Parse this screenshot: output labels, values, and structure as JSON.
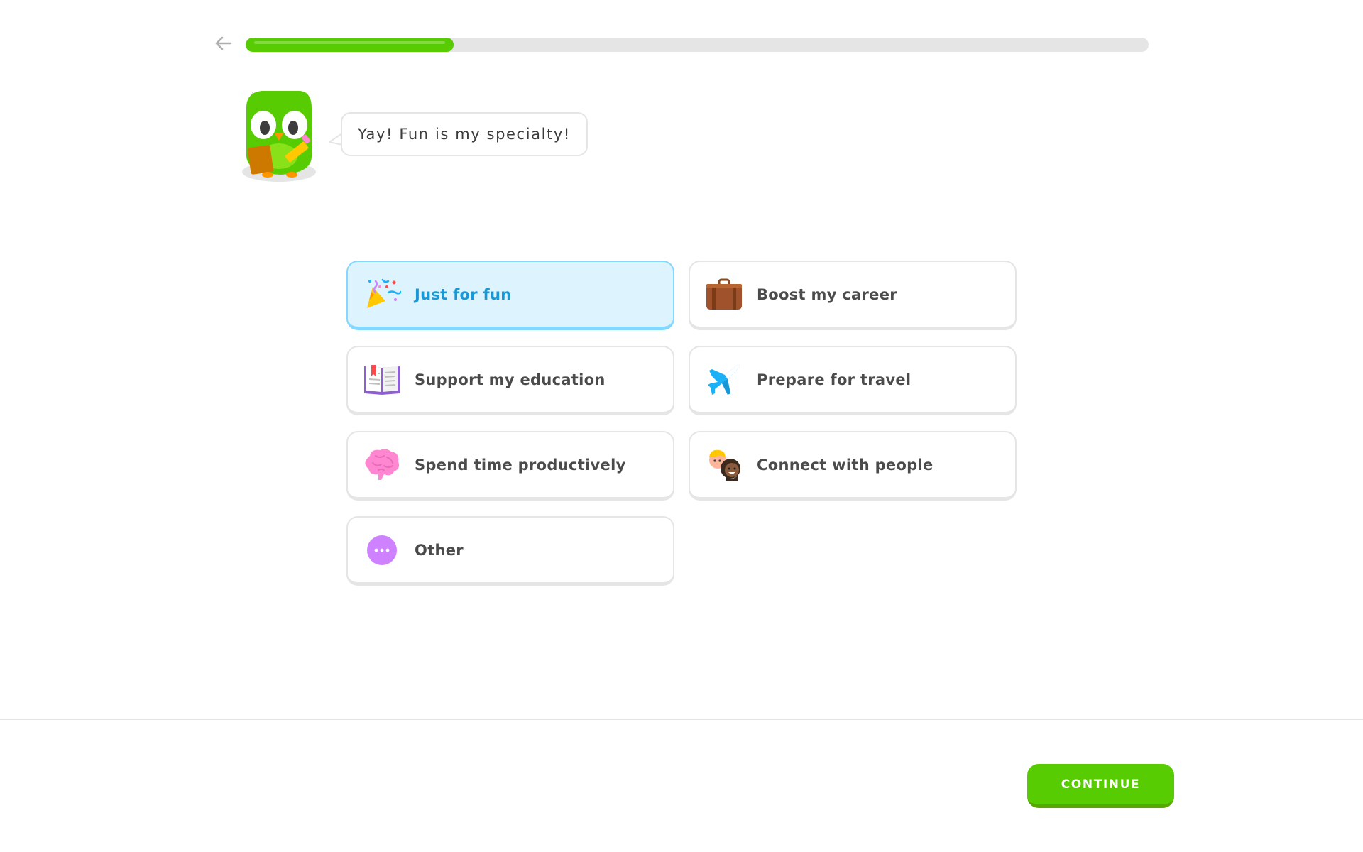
{
  "progress": {
    "value": 0.23,
    "fill_color": "#58cc02",
    "track_color": "#e5e5e5"
  },
  "header": {
    "back_icon": "arrow-left-icon"
  },
  "mascot": {
    "icon": "owl-mascot-icon",
    "speech": "Yay! Fun is my specialty!"
  },
  "options": [
    {
      "label": "Just for fun",
      "icon": "party-popper-icon",
      "selected": true
    },
    {
      "label": "Boost my career",
      "icon": "briefcase-icon",
      "selected": false
    },
    {
      "label": "Support my education",
      "icon": "open-book-icon",
      "selected": false
    },
    {
      "label": "Prepare for travel",
      "icon": "airplane-icon",
      "selected": false
    },
    {
      "label": "Spend time productively",
      "icon": "brain-icon",
      "selected": false
    },
    {
      "label": "Connect with people",
      "icon": "people-icon",
      "selected": false
    },
    {
      "label": "Other",
      "icon": "more-dots-icon",
      "selected": false
    }
  ],
  "footer": {
    "continue_label": "CONTINUE",
    "continue_color": "#58cc02"
  },
  "colors": {
    "selected_bg": "#ddf4ff",
    "selected_border": "#84d8ff",
    "selected_text": "#1899d6"
  }
}
